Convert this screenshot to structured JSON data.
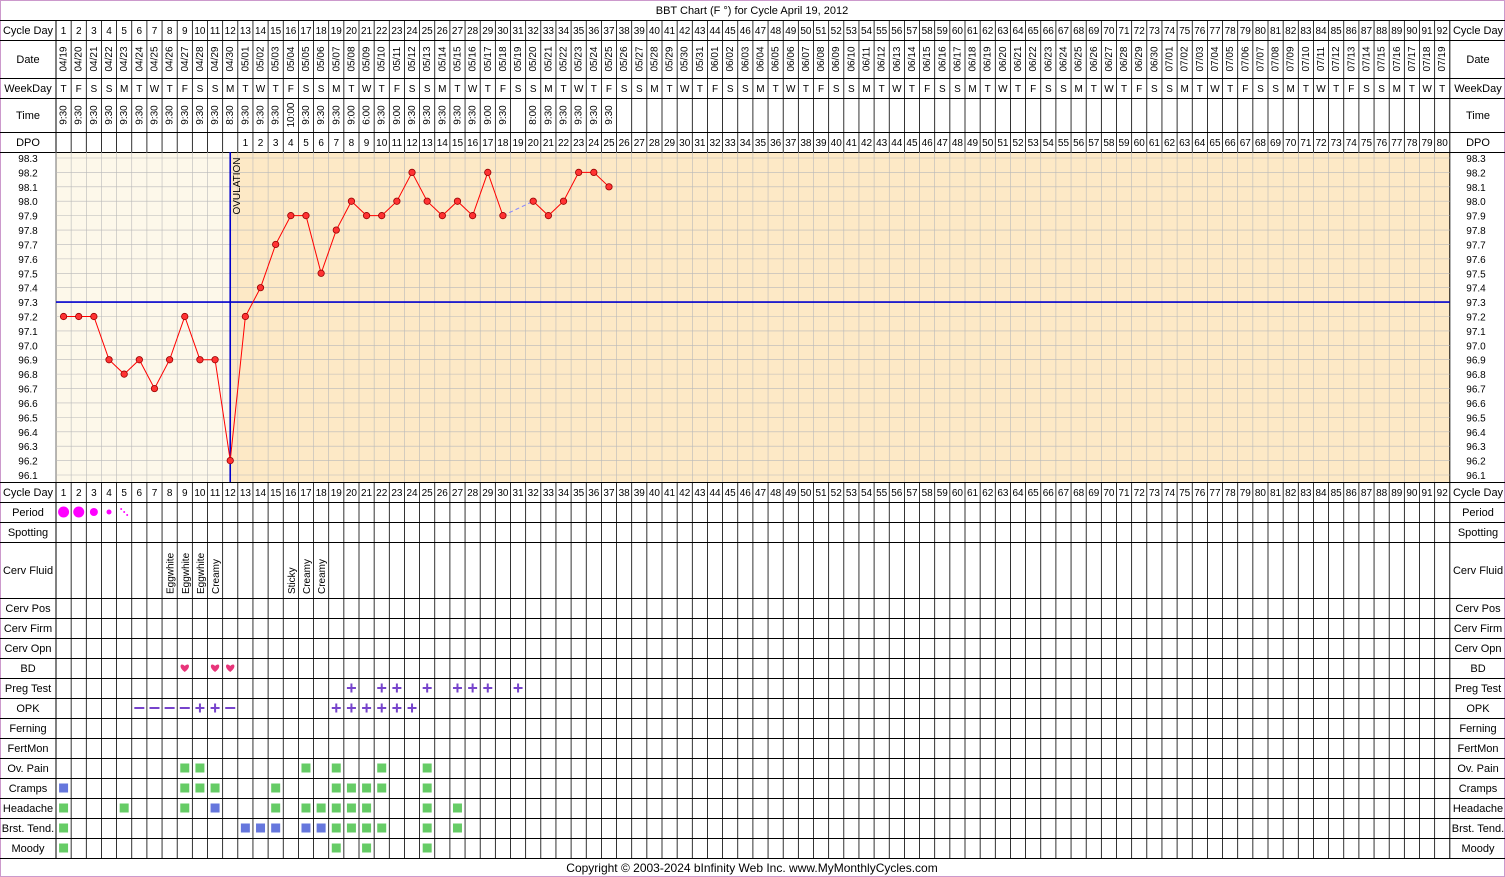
{
  "title": "BBT Chart (F °) for Cycle April 19, 2012",
  "footer": "Copyright © 2003-2024 bInfinity Web Inc.     www.MyMonthlyCycles.com",
  "ovulation_label": "OVULATION",
  "row_labels": {
    "cycle_day": "Cycle Day",
    "date": "Date",
    "weekday": "WeekDay",
    "time": "Time",
    "dpo": "DPO",
    "period": "Period",
    "spotting": "Spotting",
    "cerv_fluid": "Cerv Fluid",
    "cerv_pos": "Cerv Pos",
    "cerv_firm": "Cerv Firm",
    "cerv_opn": "Cerv Opn",
    "bd": "BD",
    "preg_test": "Preg Test",
    "opk": "OPK",
    "ferning": "Ferning",
    "fertmon": "FertMon",
    "ov_pain": "Ov. Pain",
    "cramps": "Cramps",
    "headache": "Headache",
    "brst_tend": "Brst. Tend.",
    "moody": "Moody"
  },
  "colors": {
    "frame": "#cc99cc",
    "pre_ovulation_bg": "#fdf8ea",
    "post_ovulation_bg": "#fde9c6",
    "coverline": "#0000cc",
    "temp_line": "#ff0000",
    "temp_point_fill": "#ff3333",
    "period": "#ff00ff",
    "bd_heart": "#e8357a",
    "preg_opk_marks": "#7744cc",
    "symptom_green": "#66cc66",
    "symptom_blue": "#6677dd",
    "missing_link": "#8888ff"
  },
  "days": [
    "1",
    "2",
    "3",
    "4",
    "5",
    "6",
    "7",
    "8",
    "9",
    "10",
    "11",
    "12",
    "13",
    "14",
    "15",
    "16",
    "17",
    "18",
    "19",
    "20",
    "21",
    "22",
    "23",
    "24",
    "25",
    "26",
    "27",
    "28",
    "29",
    "30",
    "31",
    "32",
    "33",
    "34",
    "35",
    "36",
    "37",
    "38",
    "39",
    "40",
    "41",
    "42",
    "43",
    "44",
    "45",
    "46",
    "47",
    "48",
    "49",
    "50",
    "51",
    "52",
    "53",
    "54",
    "55",
    "56",
    "57",
    "58",
    "59",
    "60",
    "61",
    "62",
    "63",
    "64",
    "65",
    "66",
    "67",
    "68",
    "69",
    "70",
    "71",
    "72",
    "73",
    "74",
    "75",
    "76",
    "77",
    "78",
    "79",
    "80",
    "81",
    "82",
    "83",
    "84",
    "85",
    "86",
    "87",
    "88",
    "89",
    "90",
    "91",
    "92"
  ],
  "dates": [
    "04/19",
    "04/20",
    "04/21",
    "04/22",
    "04/23",
    "04/24",
    "04/25",
    "04/26",
    "04/27",
    "04/28",
    "04/29",
    "04/30",
    "05/01",
    "05/02",
    "05/03",
    "05/04",
    "05/05",
    "05/06",
    "05/07",
    "05/08",
    "05/09",
    "05/10",
    "05/11",
    "05/12",
    "05/13",
    "05/14",
    "05/15",
    "05/16",
    "05/17",
    "05/18",
    "05/19",
    "05/20",
    "05/21",
    "05/22",
    "05/23",
    "05/24",
    "05/25",
    "05/26",
    "05/27",
    "05/28",
    "05/29",
    "05/30",
    "05/31",
    "06/01",
    "06/02",
    "06/03",
    "06/04",
    "06/05",
    "06/06",
    "06/07",
    "06/08",
    "06/09",
    "06/10",
    "06/11",
    "06/12",
    "06/13",
    "06/14",
    "06/15",
    "06/16",
    "06/17",
    "06/18",
    "06/19",
    "06/20",
    "06/21",
    "06/22",
    "06/23",
    "06/24",
    "06/25",
    "06/26",
    "06/27",
    "06/28",
    "06/29",
    "06/30",
    "07/01",
    "07/02",
    "07/03",
    "07/04",
    "07/05",
    "07/06",
    "07/07",
    "07/08",
    "07/09",
    "07/10",
    "07/11",
    "07/12",
    "07/13",
    "07/14",
    "07/15",
    "07/16",
    "07/17",
    "07/18",
    "07/19"
  ],
  "weekdays": [
    "T",
    "F",
    "S",
    "S",
    "M",
    "T",
    "W",
    "T",
    "F",
    "S",
    "S",
    "M",
    "T",
    "W",
    "T",
    "F",
    "S",
    "S",
    "M",
    "T",
    "W",
    "T",
    "F",
    "S",
    "S",
    "M",
    "T",
    "W",
    "T",
    "F",
    "S",
    "S",
    "M",
    "T",
    "W",
    "T",
    "F",
    "S",
    "S",
    "M",
    "T",
    "W",
    "T",
    "F",
    "S",
    "S",
    "M",
    "T",
    "W",
    "T",
    "F",
    "S",
    "S",
    "M",
    "T",
    "W",
    "T",
    "F",
    "S",
    "S",
    "M",
    "T",
    "W",
    "T",
    "F",
    "S",
    "S",
    "M",
    "T",
    "W",
    "T",
    "F",
    "S",
    "S",
    "M",
    "T",
    "W",
    "T",
    "F",
    "S",
    "S",
    "M",
    "T",
    "W",
    "T",
    "F",
    "S",
    "S",
    "M",
    "T",
    "W",
    "T"
  ],
  "times": [
    "9:30",
    "9:30",
    "9:30",
    "9:30",
    "9:30",
    "9:30",
    "9:30",
    "9:30",
    "9:30",
    "9:30",
    "9:30",
    "8:30",
    "9:30",
    "9:30",
    "9:30",
    "10:00",
    "9:30",
    "9:30",
    "9:30",
    "9:00",
    "6:00",
    "9:30",
    "9:00",
    "9:30",
    "9:30",
    "9:30",
    "9:30",
    "9:30",
    "9:00",
    "9:30",
    "",
    "8:00",
    "9:30",
    "9:30",
    "9:30",
    "9:30",
    "9:30"
  ],
  "dpo": [
    "",
    "",
    "",
    "",
    "",
    "",
    "",
    "",
    "",
    "",
    "",
    "",
    "1",
    "2",
    "3",
    "4",
    "5",
    "6",
    "7",
    "8",
    "9",
    "10",
    "11",
    "12",
    "13",
    "14",
    "15",
    "16",
    "17",
    "18",
    "19",
    "20",
    "21",
    "22",
    "23",
    "24",
    "25",
    "26",
    "27",
    "28",
    "29",
    "30",
    "31",
    "32",
    "33",
    "34",
    "35",
    "36",
    "37",
    "38",
    "39",
    "40",
    "41",
    "42",
    "43",
    "44",
    "45",
    "46",
    "47",
    "48",
    "49",
    "50",
    "51",
    "52",
    "53",
    "54",
    "55",
    "56",
    "57",
    "58",
    "59",
    "60",
    "61",
    "62",
    "63",
    "64",
    "65",
    "66",
    "67",
    "68",
    "69",
    "70",
    "71",
    "72",
    "73",
    "74",
    "75",
    "76",
    "77",
    "78",
    "79",
    "80"
  ],
  "temp_labels": [
    "98.3",
    "98.2",
    "98.1",
    "98.0",
    "97.9",
    "97.8",
    "97.7",
    "97.6",
    "97.5",
    "97.4",
    "97.3",
    "97.2",
    "97.1",
    "97.0",
    "96.9",
    "96.8",
    "96.7",
    "96.6",
    "96.5",
    "96.4",
    "96.3",
    "96.2",
    "96.1"
  ],
  "cerv_fluid": {
    "8": "Eggwhite",
    "9": "Eggwhite",
    "10": "Eggwhite",
    "11": "Creamy",
    "16": "Sticky",
    "17": "Creamy",
    "18": "Creamy"
  },
  "chart_data": {
    "type": "line",
    "title": "BBT Chart (F °) for Cycle April 19, 2012",
    "xlabel": "Cycle Day",
    "ylabel": "",
    "ylim": [
      96.1,
      98.3
    ],
    "ovulation_day": 12,
    "coverline": 97.3,
    "grid": true,
    "x": [
      1,
      2,
      3,
      4,
      5,
      6,
      7,
      8,
      9,
      10,
      11,
      12,
      13,
      14,
      15,
      16,
      17,
      18,
      19,
      20,
      21,
      22,
      23,
      24,
      25,
      26,
      27,
      28,
      29,
      30,
      32,
      33,
      34,
      35,
      36,
      37
    ],
    "temps": [
      97.2,
      97.2,
      97.2,
      96.9,
      96.8,
      96.9,
      96.7,
      96.9,
      97.2,
      96.9,
      96.9,
      96.2,
      97.2,
      97.4,
      97.7,
      97.9,
      97.9,
      97.5,
      97.8,
      98.0,
      97.9,
      97.9,
      98.0,
      98.2,
      98.0,
      97.9,
      98.0,
      97.9,
      98.2,
      97.9,
      98.0,
      97.9,
      98.0,
      98.2,
      98.2,
      98.1
    ],
    "missing_days": [
      31
    ]
  },
  "period": {
    "1": "heavy",
    "2": "heavy",
    "3": "medium",
    "4": "light",
    "5": "spotting"
  },
  "bd": [
    9,
    11,
    12
  ],
  "preg_test": [
    20,
    22,
    23,
    25,
    27,
    28,
    29,
    31
  ],
  "opk": {
    "6": "-",
    "7": "-",
    "8": "-",
    "9": "-",
    "10": "+",
    "11": "+",
    "12": "-",
    "19": "+",
    "20": "+",
    "21": "+",
    "22": "+",
    "23": "+",
    "24": "+"
  },
  "ov_pain": {
    "9": "green",
    "10": "green",
    "17": "green",
    "19": "green",
    "22": "green",
    "25": "green"
  },
  "cramps": {
    "1": "blue",
    "9": "green",
    "10": "green",
    "11": "green",
    "15": "green",
    "19": "green",
    "20": "green",
    "21": "green",
    "22": "green",
    "25": "green"
  },
  "headache": {
    "1": "green",
    "5": "green",
    "9": "green",
    "11": "blue",
    "15": "green",
    "17": "green",
    "18": "green",
    "19": "green",
    "20": "green",
    "21": "green",
    "25": "green",
    "27": "green"
  },
  "brst_tend": {
    "1": "green",
    "13": "blue",
    "14": "blue",
    "15": "blue",
    "17": "blue",
    "18": "blue",
    "19": "green",
    "20": "green",
    "21": "green",
    "22": "green",
    "25": "green",
    "27": "green"
  },
  "moody": {
    "1": "green",
    "19": "green",
    "21": "green",
    "25": "green"
  }
}
